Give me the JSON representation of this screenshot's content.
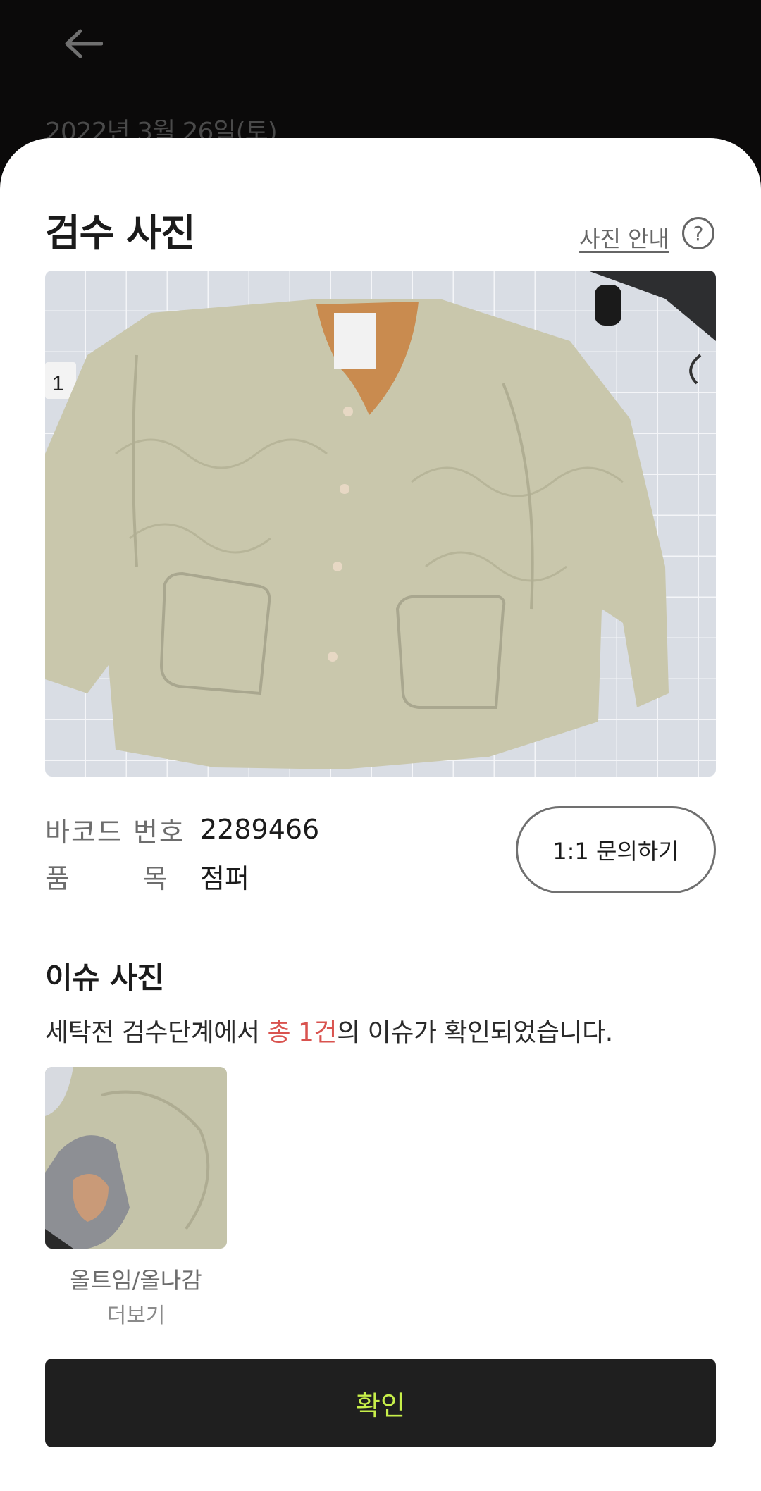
{
  "background": {
    "date": "2022년 3월 26일(토)"
  },
  "sheet": {
    "title": "검수 사진",
    "guide_link": "사진 안내",
    "help_symbol": "?",
    "main_photo": {
      "tag_number": "1"
    },
    "info": {
      "barcode_label": "바코드 번호",
      "barcode_value": "2289466",
      "item_label_first": "품",
      "item_label_second": "목",
      "item_value": "점퍼"
    },
    "inquiry_button": "1:1 문의하기",
    "issue": {
      "title": "이슈 사진",
      "desc_prefix": "세탁전 검수단계에서 ",
      "desc_highlight": "총 1건",
      "desc_suffix": "의 이슈가 확인되었습니다.",
      "photo_caption": "올트임/올나감",
      "more_label": "더보기"
    },
    "confirm_button": "확인"
  },
  "colors": {
    "accent": "#c7ef4a",
    "highlight": "#d9534f",
    "dark_button": "#1f1f1f"
  },
  "icons": [
    "back-arrow-icon",
    "help-icon"
  ]
}
